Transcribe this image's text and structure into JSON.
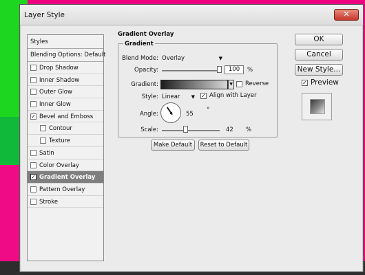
{
  "window": {
    "title": "Layer Style",
    "close_glyph": "✕"
  },
  "styles_list": {
    "header": "Styles",
    "blending_options": "Blending Options: Default",
    "items": [
      {
        "label": "Drop Shadow",
        "checked": false,
        "sub": false,
        "selected": false
      },
      {
        "label": "Inner Shadow",
        "checked": false,
        "sub": false,
        "selected": false
      },
      {
        "label": "Outer Glow",
        "checked": false,
        "sub": false,
        "selected": false
      },
      {
        "label": "Inner Glow",
        "checked": false,
        "sub": false,
        "selected": false
      },
      {
        "label": "Bevel and Emboss",
        "checked": true,
        "sub": false,
        "selected": false
      },
      {
        "label": "Contour",
        "checked": false,
        "sub": true,
        "selected": false
      },
      {
        "label": "Texture",
        "checked": false,
        "sub": true,
        "selected": false
      },
      {
        "label": "Satin",
        "checked": false,
        "sub": false,
        "selected": false
      },
      {
        "label": "Color Overlay",
        "checked": false,
        "sub": false,
        "selected": false
      },
      {
        "label": "Gradient Overlay",
        "checked": true,
        "sub": false,
        "selected": true
      },
      {
        "label": "Pattern Overlay",
        "checked": false,
        "sub": false,
        "selected": false
      },
      {
        "label": "Stroke",
        "checked": false,
        "sub": false,
        "selected": false
      }
    ]
  },
  "panel": {
    "section_title": "Gradient Overlay",
    "group_title": "Gradient",
    "blend_mode": {
      "label": "Blend Mode:",
      "value": "Overlay"
    },
    "opacity": {
      "label": "Opacity:",
      "value": "100",
      "unit": "%",
      "slider_fraction": 1.0
    },
    "gradient": {
      "label": "Gradient:",
      "reverse_label": "Reverse",
      "reverse_checked": false
    },
    "style": {
      "label": "Style:",
      "value": "Linear",
      "align_label": "Align with Layer",
      "align_checked": true
    },
    "angle": {
      "label": "Angle:",
      "value": "55",
      "unit": "°"
    },
    "scale": {
      "label": "Scale:",
      "value": "42",
      "unit": "%",
      "slider_fraction": 0.42
    },
    "make_default": "Make Default",
    "reset_default": "Reset to Default"
  },
  "buttons": {
    "ok": "OK",
    "cancel": "Cancel",
    "new_style": "New Style...",
    "preview_label": "Preview",
    "preview_checked": true
  }
}
